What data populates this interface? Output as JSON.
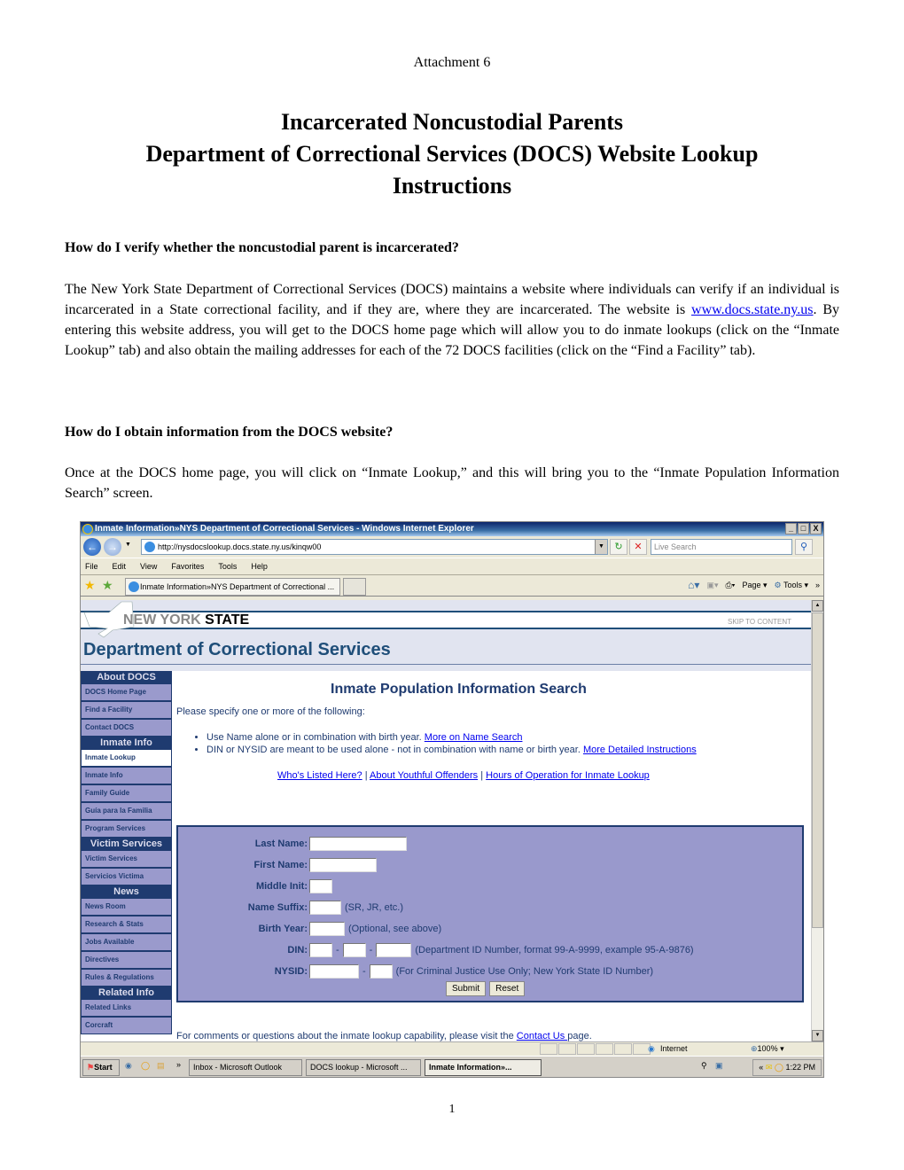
{
  "document": {
    "attachment": "Attachment 6",
    "title_lines": [
      "Incarcerated Noncustodial Parents",
      "Department of Correctional Services (DOCS) Website Lookup",
      "Instructions"
    ],
    "q1": "How do I verify whether the noncustodial parent is incarcerated?",
    "p1_before": "The New York State Department of Correctional Services (DOCS) maintains a website where individuals can verify if an individual is incarcerated in a State correctional facility, and if they are, where they are incarcerated.  The website is ",
    "p1_link": "www.docs.state.ny.us",
    "p1_after": ".  By entering this website address, you will get to the DOCS home page which will allow you to do inmate lookups (click on the “Inmate Lookup” tab) and also obtain the mailing addresses for each of the 72 DOCS facilities (click on the “Find a Facility” tab).",
    "q2": "How do I obtain information from the DOCS website?",
    "p2": "Once at the DOCS home page, you will click on “Inmate Lookup,” and this will bring you to the “Inmate Population Information Search” screen.",
    "page_number": "1"
  },
  "browser": {
    "window_title": "Inmate Information»NYS Department of Correctional Services - Windows Internet Explorer",
    "window_buttons": [
      "_",
      "□",
      "X"
    ],
    "url": "http://nysdocslookup.docs.state.ny.us/kinqw00",
    "search_placeholder": "Live Search",
    "menu": [
      "File",
      "Edit",
      "View",
      "Favorites",
      "Tools",
      "Help"
    ],
    "tab_label": "Inmate Information»NYS Department of Correctional ...",
    "command_bar": [
      "Page",
      "Tools"
    ],
    "status_zone": "Internet",
    "zoom_level": "100%"
  },
  "site": {
    "logo_gray": "NEW YORK ",
    "logo_black": "STATE",
    "skip": "SKIP TO CONTENT",
    "department": "Department of Correctional Services",
    "sidebar": [
      {
        "type": "head",
        "label": "About DOCS"
      },
      {
        "type": "item",
        "label": "DOCS Home Page"
      },
      {
        "type": "item",
        "label": "Find a Facility"
      },
      {
        "type": "item",
        "label": "Contact DOCS"
      },
      {
        "type": "head",
        "label": "Inmate Info"
      },
      {
        "type": "item",
        "label": "Inmate Lookup",
        "active": true
      },
      {
        "type": "item",
        "label": "Inmate Info"
      },
      {
        "type": "item",
        "label": "Family Guide"
      },
      {
        "type": "item",
        "label": "Guía para la Familia"
      },
      {
        "type": "item",
        "label": "Program Services"
      },
      {
        "type": "head",
        "label": "Victim Services"
      },
      {
        "type": "item",
        "label": "Victim Services"
      },
      {
        "type": "item",
        "label": "Servicios Victima"
      },
      {
        "type": "head",
        "label": "News"
      },
      {
        "type": "item",
        "label": "News Room"
      },
      {
        "type": "item",
        "label": "Research & Stats"
      },
      {
        "type": "item",
        "label": "Jobs Available"
      },
      {
        "type": "item",
        "label": "Directives"
      },
      {
        "type": "item",
        "label": "Rules & Regulations"
      },
      {
        "type": "head",
        "label": "Related Info"
      },
      {
        "type": "item",
        "label": "Related Links"
      },
      {
        "type": "item",
        "label": "Corcraft"
      }
    ],
    "heading": "Inmate Population Information Search",
    "please": "Please specify one or more of the following:",
    "bullet1_text": "Use Name alone or in combination with birth year. ",
    "bullet1_link": "More on Name Search",
    "bullet2_text": "DIN or NYSID are meant to be used alone - not in combination with name or birth year. ",
    "bullet2_link": "More Detailed Instructions",
    "links": [
      "Who's Listed Here?",
      "About Youthful Offenders",
      "Hours of Operation for Inmate Lookup"
    ],
    "form": {
      "last_name": "Last Name:",
      "first_name": "First Name:",
      "middle_init": "Middle Init:",
      "name_suffix": "Name Suffix:",
      "suffix_hint": "(SR, JR, etc.)",
      "birth_year": "Birth Year:",
      "birth_hint": "(Optional, see above)",
      "din": "DIN:",
      "din_hint": "(Department ID Number, format 99-A-9999, example 95-A-9876)",
      "nysid": "NYSID:",
      "nysid_hint": "(For Criminal Justice Use Only; New York State ID Number)",
      "submit": "Submit",
      "reset": "Reset"
    },
    "comments_before": "For comments or questions about the inmate lookup capability, please visit the ",
    "comments_link": "Contact Us ",
    "comments_after": "page."
  },
  "taskbar": {
    "start": "Start",
    "items": [
      "Inbox - Microsoft Outlook",
      "DOCS lookup - Microsoft ...",
      "Inmate Information»..."
    ],
    "clock": "1:22 PM"
  }
}
